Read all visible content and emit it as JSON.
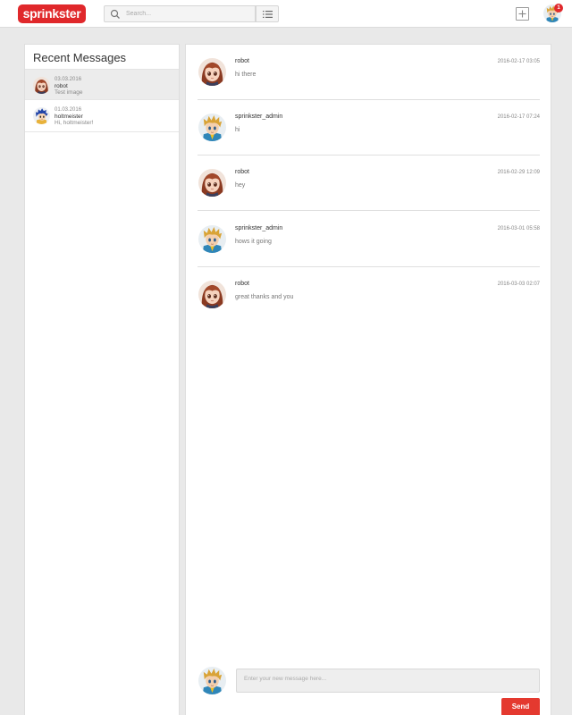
{
  "app": {
    "logo_text": "sprinkster",
    "brand_color": "#e0282b"
  },
  "search": {
    "placeholder": "Search..."
  },
  "header": {
    "notification_count": "1",
    "add_icon": "plus-square-icon",
    "list_icon": "list-icon"
  },
  "sidebar": {
    "title": "Recent Messages",
    "conversations": [
      {
        "date": "03.03.2016",
        "name": "robot",
        "preview": "Test image",
        "avatar": "girl-avatar",
        "active": true
      },
      {
        "date": "01.03.2016",
        "name": "holtmeister",
        "preview": "Hi, holtmeister!",
        "avatar": "blue-boy-avatar",
        "active": false
      }
    ]
  },
  "thread": {
    "messages": [
      {
        "author": "robot",
        "time": "2016-02-17 03:05",
        "text": "hi there",
        "avatar": "girl-avatar"
      },
      {
        "author": "sprinkster_admin",
        "time": "2016-02-17 07:24",
        "text": "hi",
        "avatar": "boy-avatar"
      },
      {
        "author": "robot",
        "time": "2016-02-29 12:09",
        "text": "hey",
        "avatar": "girl-avatar"
      },
      {
        "author": "sprinkster_admin",
        "time": "2016-03-01 05:58",
        "text": "hows it going",
        "avatar": "boy-avatar"
      },
      {
        "author": "robot",
        "time": "2016-03-03 02:07",
        "text": "great thanks and you",
        "avatar": "girl-avatar"
      }
    ]
  },
  "composer": {
    "placeholder": "Enter your new message here...",
    "send_label": "Send"
  }
}
